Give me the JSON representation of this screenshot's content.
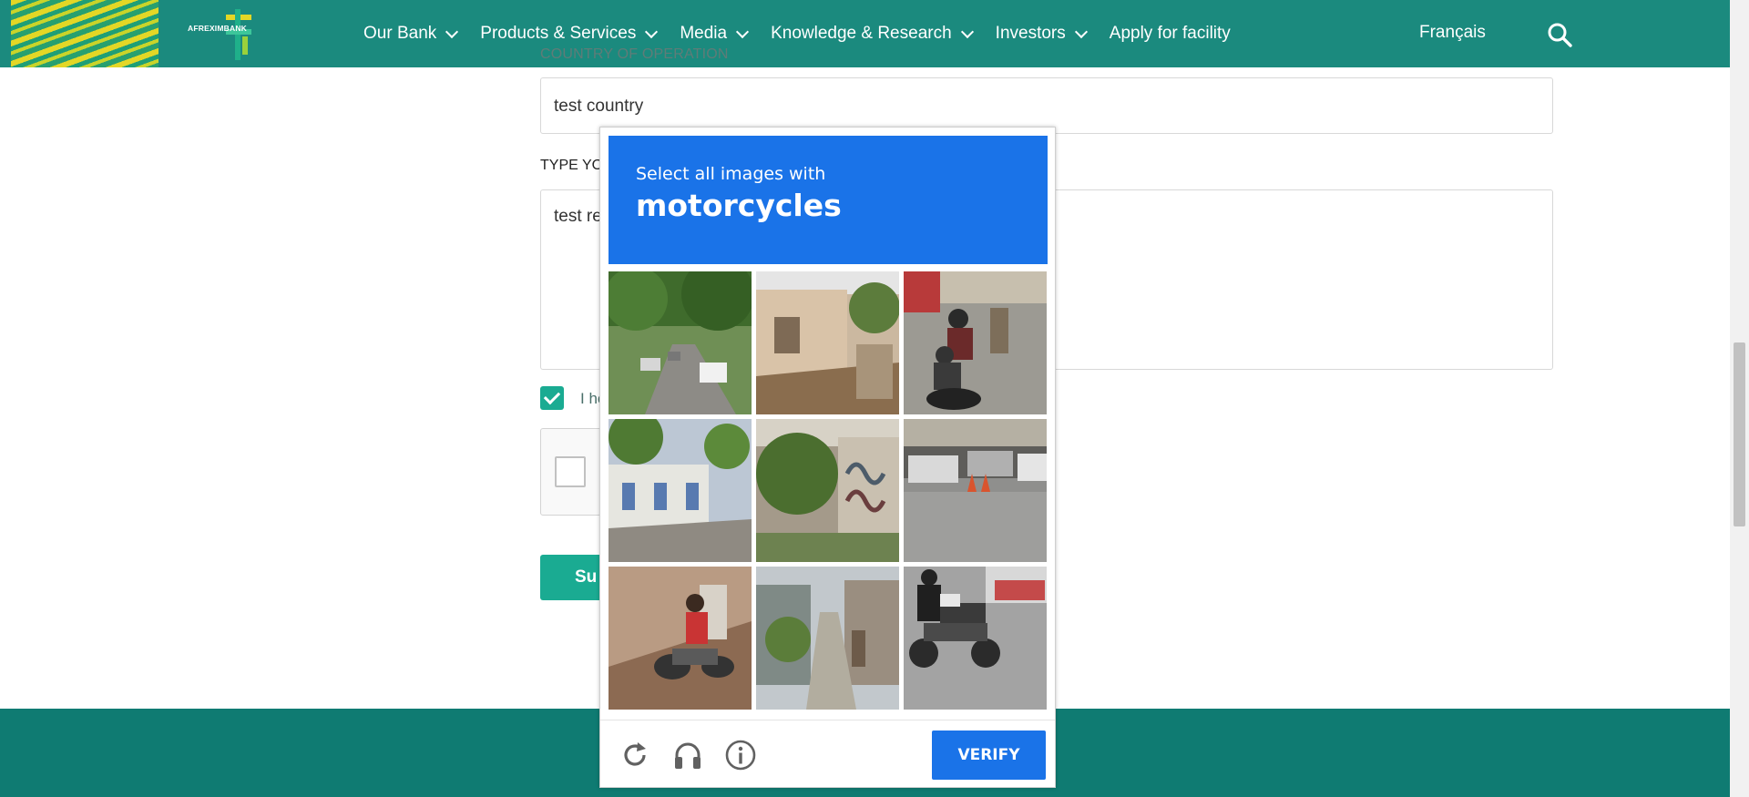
{
  "header": {
    "logo_text": "AFREXIMBANK",
    "nav": [
      {
        "label": "Our Bank",
        "dropdown": true
      },
      {
        "label": "Products & Services",
        "dropdown": true
      },
      {
        "label": "Media",
        "dropdown": true
      },
      {
        "label": "Knowledge & Research",
        "dropdown": true
      },
      {
        "label": "Investors",
        "dropdown": true
      },
      {
        "label": "Apply for facility",
        "dropdown": false
      }
    ],
    "language": "Français"
  },
  "form": {
    "country_label": "COUNTRY OF OPERATION",
    "country_value": "test country",
    "message_label_visible": "TYPE YO",
    "message_value_visible": "test re",
    "agree_visible": "I he",
    "agree_checked": true,
    "submit_visible": "Su"
  },
  "captcha": {
    "instruction": "Select all images with",
    "target": "motorcycles",
    "verify_label": "VERIFY",
    "tiles": [
      {
        "scene": "tree-lined street with parked cars"
      },
      {
        "scene": "old house with fallen wall"
      },
      {
        "scene": "riders on motorcycle in street"
      },
      {
        "scene": "white houses along cobbled road"
      },
      {
        "scene": "tree and graffiti wall"
      },
      {
        "scene": "parked cars and traffic cones"
      },
      {
        "scene": "person on scooter on slope"
      },
      {
        "scene": "narrow alley with houses"
      },
      {
        "scene": "rider on large motorcycle"
      }
    ]
  },
  "colors": {
    "header": "#1b8a7e",
    "footer": "#0f7b72",
    "accent": "#1aab92",
    "captcha_blue": "#1a73e8"
  }
}
